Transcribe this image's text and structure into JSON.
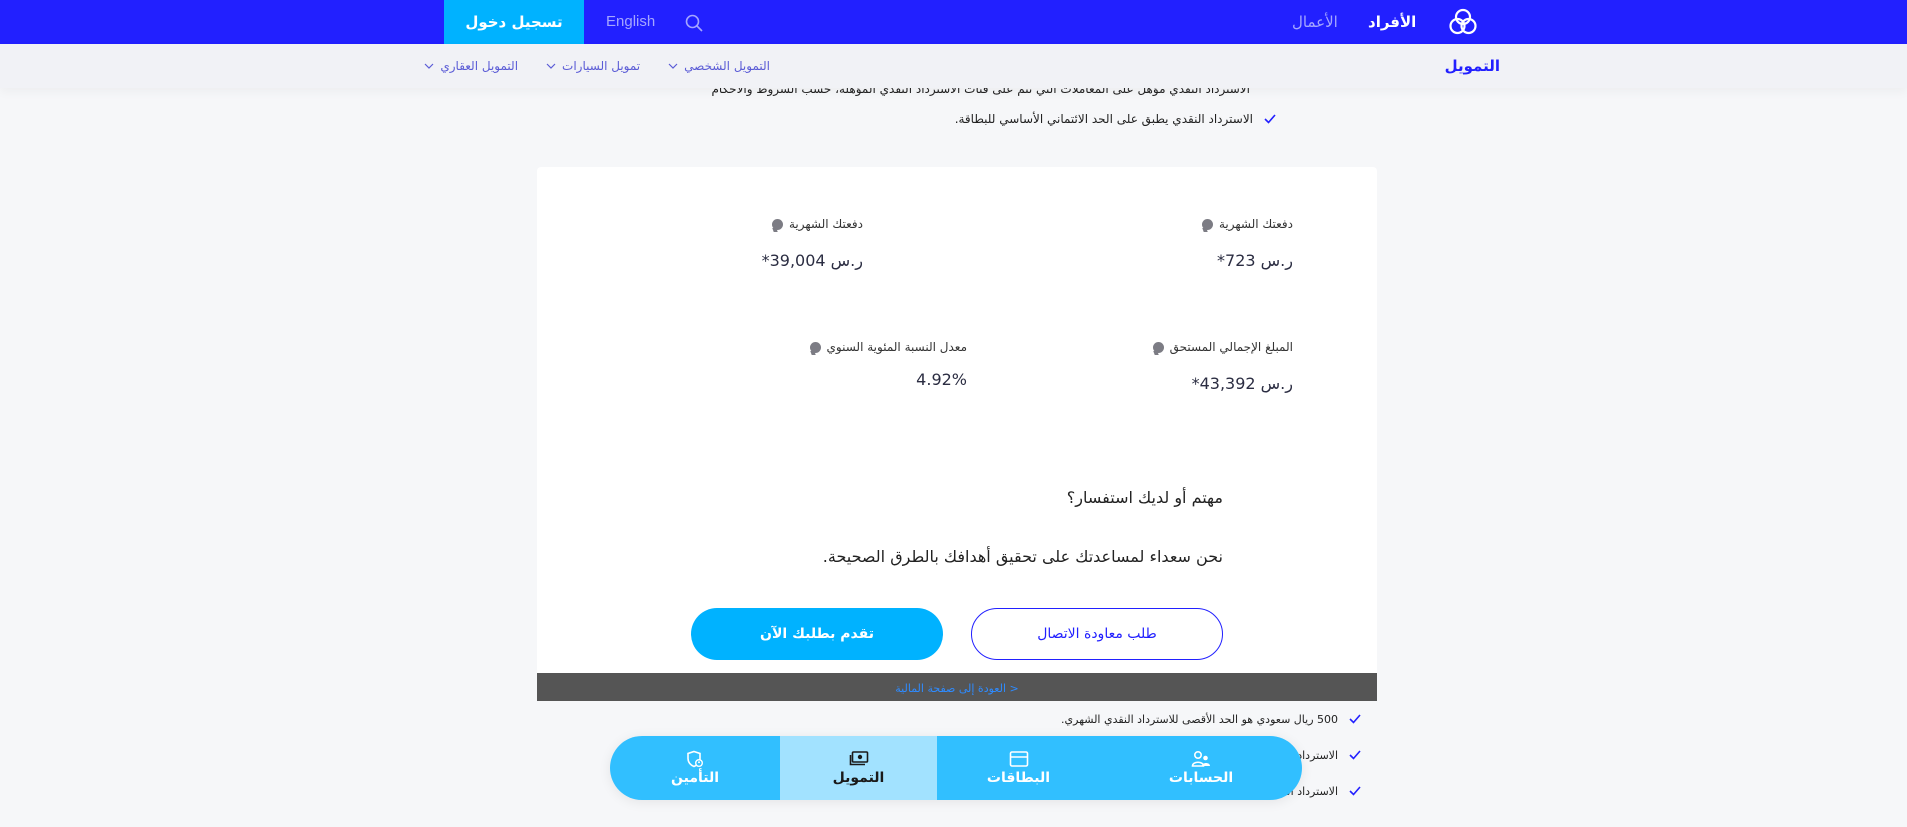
{
  "topbar": {
    "brand_icon": "bank-logo-icon",
    "nav": [
      {
        "label": "الأفراد",
        "active": true
      },
      {
        "label": "الأعمال",
        "active": false
      }
    ],
    "login_label": "تسجيل دخول",
    "language_label": "English",
    "search_icon": "search-icon"
  },
  "subnav": {
    "title": "التمويل",
    "items": [
      {
        "label": "التمويل العقاري"
      },
      {
        "label": "تمويل السيارات"
      },
      {
        "label": "التمويل الشخصي"
      }
    ]
  },
  "top_bullets": [
    "الاسترداد النقدي مؤهل على المعاملات التي تتم على فئات الاسترداد النقدي المؤهلة، حسب الشروط والأحكام",
    "الاسترداد النقدي يطبق على الحد الائتماني الأساسي للبطاقة."
  ],
  "metrics": [
    {
      "label": "دفعتك الشهرية",
      "value": "ر.س 723*"
    },
    {
      "label": "دفعتك الشهرية",
      "value": "ر.س 39,004*"
    },
    {
      "label": "المبلغ الإجمالي المستحق",
      "value": "ر.س 43,392*"
    },
    {
      "label": "معدل النسبة المئوية السنوي",
      "value": "4.92%"
    }
  ],
  "cta": {
    "title": "مهتم أو لديك استفسار؟",
    "description": "نحن سعداء لمساعدتك على تحقيق أهدافك بالطرق الصحيحة.",
    "callback_label": "طلب معاودة الاتصال",
    "apply_label": "تقدم بطلبك الآن"
  },
  "back_link": "العودة إلى صفحة المالية >",
  "bottom_bullets": [
    "500 ريال سعودي هو الحد الأقصى للاسترداد النقدي الشهري.",
    "الاسترداد النقدي مؤهل على المعاملات",
    "الاسترداد النقدي يطبق على الحد الائتماني الأساسي للبطاقة."
  ],
  "bottom_nav": [
    {
      "label": "الحسابات",
      "icon": "accounts-icon",
      "active": false
    },
    {
      "label": "البطاقات",
      "icon": "card-icon",
      "active": false
    },
    {
      "label": "التمويل",
      "icon": "finance-icon",
      "active": true
    },
    {
      "label": "التأمين",
      "icon": "insurance-icon",
      "active": false
    }
  ],
  "colors": {
    "primary": "#2220ff",
    "accent": "#00b2ff",
    "bottom_nav": "#31bfff",
    "bottom_nav_active": "#a2e2ff",
    "back_bar": "#555555"
  }
}
